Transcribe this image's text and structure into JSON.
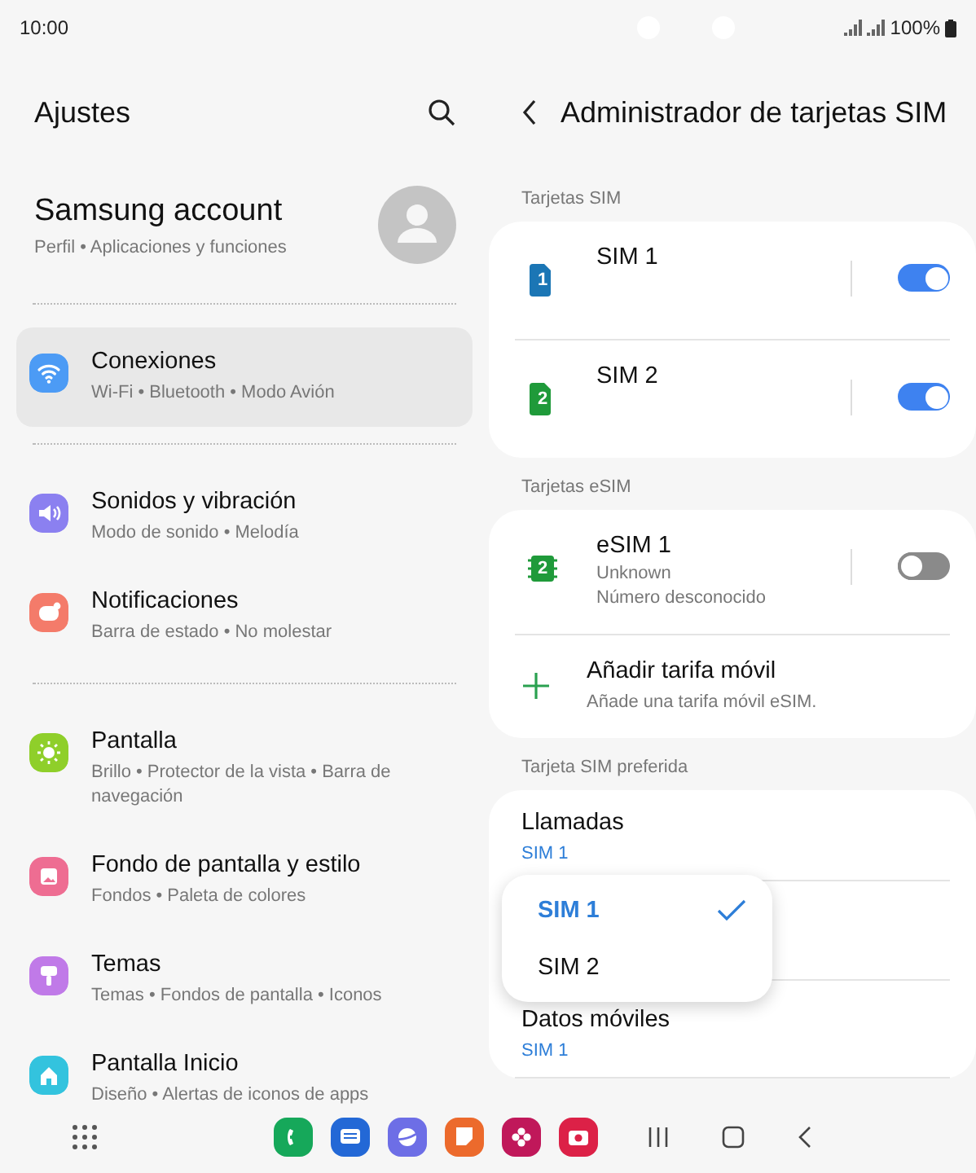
{
  "status_bar": {
    "time": "10:00",
    "battery": "100%"
  },
  "settings": {
    "title": "Ajustes",
    "account": {
      "name": "Samsung account",
      "subtitle": "Perfil • Aplicaciones y funciones"
    },
    "groups": [
      [
        {
          "kind": "wifi",
          "color": "#4c9bf5",
          "title": "Conexiones",
          "subtitle": "Wi-Fi • Bluetooth • Modo Avión",
          "selected": true
        }
      ],
      [
        {
          "kind": "sound",
          "color": "#8b80f0",
          "title": "Sonidos y vibración",
          "subtitle": "Modo de sonido • Melodía",
          "selected": false
        },
        {
          "kind": "bell",
          "color": "#f47b6a",
          "title": "Notificaciones",
          "subtitle": "Barra de estado • No molestar",
          "selected": false
        }
      ],
      [
        {
          "kind": "sun",
          "color": "#8fcf2a",
          "title": "Pantalla",
          "subtitle": "Brillo • Protector de la vista • Barra de navegación",
          "selected": false
        },
        {
          "kind": "image",
          "color": "#ee6d92",
          "title": "Fondo de pantalla y estilo",
          "subtitle": "Fondos • Paleta de colores",
          "selected": false
        },
        {
          "kind": "brush",
          "color": "#c07ae8",
          "title": "Temas",
          "subtitle": "Temas • Fondos de pantalla • Iconos",
          "selected": false
        },
        {
          "kind": "home",
          "color": "#33c3de",
          "title": "Pantalla Inicio",
          "subtitle": "Diseño • Alertas de iconos de apps",
          "selected": false
        }
      ]
    ]
  },
  "sim_manager": {
    "title": "Administrador de tarjetas SIM",
    "sections": [
      {
        "label": "Tarjetas SIM",
        "rows": [
          {
            "kind": "sim",
            "badge": "1",
            "color": "#1b76b5",
            "title": "SIM 1",
            "on": true
          },
          {
            "kind": "sim",
            "badge": "2",
            "color": "#1f9a3a",
            "title": "SIM 2",
            "on": true
          }
        ]
      },
      {
        "label": "Tarjetas eSIM",
        "rows": [
          {
            "kind": "esim",
            "badge": "2",
            "color": "#1f9a3a",
            "title": "eSIM 1",
            "lines": [
              "Unknown",
              "Número desconocido"
            ],
            "on": false
          },
          {
            "kind": "add",
            "title": "Añadir tarifa móvil",
            "subtitle": "Añade una tarifa móvil eSIM."
          }
        ]
      },
      {
        "label": "Tarjeta SIM preferida",
        "rows": [
          {
            "kind": "pref",
            "title": "Llamadas",
            "value": "SIM 1"
          },
          {
            "kind": "pref",
            "title": "Datos móviles",
            "value": "SIM 1"
          }
        ]
      }
    ],
    "popup": {
      "options": [
        {
          "label": "SIM 1",
          "selected": true
        },
        {
          "label": "SIM 2",
          "selected": false
        }
      ]
    }
  }
}
